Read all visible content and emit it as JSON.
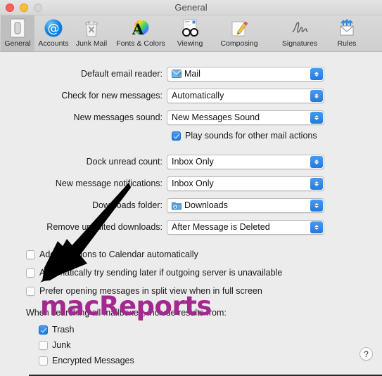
{
  "window": {
    "title": "General",
    "traffic_lights": [
      {
        "name": "close",
        "color": "#ff5f57"
      },
      {
        "name": "minimize",
        "color": "#ffbd2e"
      },
      {
        "name": "zoom",
        "color": "#d4d4d4"
      }
    ]
  },
  "toolbar": {
    "tabs": [
      {
        "label": "General",
        "icon": "general-icon",
        "selected": true
      },
      {
        "label": "Accounts",
        "icon": "at-sign-icon",
        "selected": false
      },
      {
        "label": "Junk Mail",
        "icon": "trash-x-icon",
        "selected": false
      },
      {
        "label": "Fonts & Colors",
        "icon": "color-wheel-a-icon",
        "selected": false
      },
      {
        "label": "Viewing",
        "icon": "glasses-icon",
        "selected": false
      },
      {
        "label": "Composing",
        "icon": "pencil-paper-icon",
        "selected": false
      },
      {
        "label": "Signatures",
        "icon": "signature-icon",
        "selected": false
      },
      {
        "label": "Rules",
        "icon": "envelope-arrows-icon",
        "selected": false
      }
    ]
  },
  "form": {
    "rows": [
      {
        "label": "Default email reader:",
        "value": "Mail",
        "glyph": "mail-app-icon"
      },
      {
        "label": "Check for new messages:",
        "value": "Automatically",
        "glyph": null
      },
      {
        "label": "New messages sound:",
        "value": "New Messages Sound",
        "glyph": null
      },
      {
        "label": "Dock unread count:",
        "value": "Inbox Only",
        "glyph": null
      },
      {
        "label": "New message notifications:",
        "value": "Inbox Only",
        "glyph": null
      },
      {
        "label": "Downloads folder:",
        "value": "Downloads",
        "glyph": "downloads-folder-icon"
      },
      {
        "label": "Remove unedited downloads:",
        "value": "After Message is Deleted",
        "glyph": null
      }
    ],
    "play_sounds": {
      "label": "Play sounds for other mail actions",
      "checked": true
    },
    "options": [
      {
        "label": "Add invitations to Calendar automatically",
        "checked": false
      },
      {
        "label": "Automatically try sending later if outgoing server is unavailable",
        "checked": false
      },
      {
        "label": "Prefer opening messages in split view when in full screen",
        "checked": false
      }
    ],
    "search_section": {
      "label": "When searching all mailboxes, include results from:",
      "items": [
        {
          "label": "Trash",
          "checked": true
        },
        {
          "label": "Junk",
          "checked": false
        },
        {
          "label": "Encrypted Messages",
          "checked": false
        }
      ]
    }
  },
  "help_button": {
    "label": "?"
  },
  "annotation": {
    "watermark": "macReports",
    "watermark_color": "#a3288f",
    "arrow_color": "#000000"
  }
}
